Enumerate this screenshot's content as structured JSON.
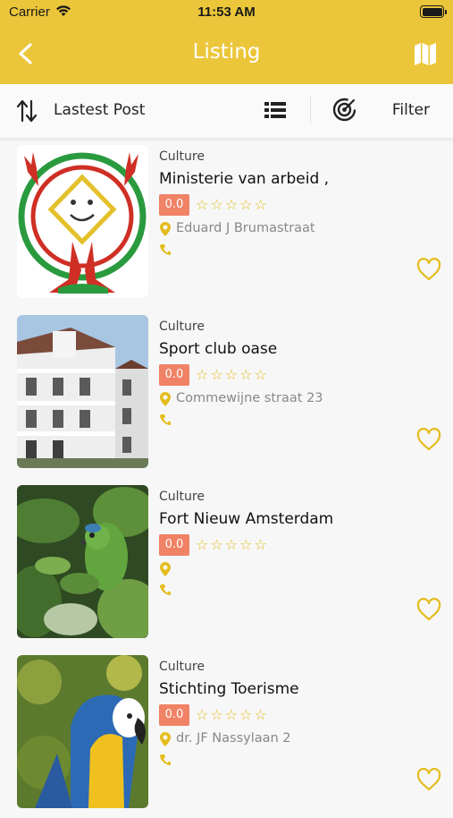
{
  "status_bar": {
    "carrier": "Carrier",
    "time": "11:53 AM"
  },
  "header": {
    "title": "Listing",
    "back_icon": "chevron-left-icon",
    "map_icon": "map-icon"
  },
  "toolbar": {
    "sort_label": "Lastest Post",
    "filter_label": "Filter"
  },
  "colors": {
    "accent": "#ecc63a",
    "rating_badge": "#f08266",
    "star": "#e4bc1c"
  },
  "listings": [
    {
      "category": "Culture",
      "name": "Ministerie van arbeid ,",
      "rating": "0.0",
      "stars": "☆☆☆☆☆",
      "address": "Eduard J Brumastraat"
    },
    {
      "category": "Culture",
      "name": "Sport club oase",
      "rating": "0.0",
      "stars": "☆☆☆☆☆",
      "address": "Commewijne straat 23"
    },
    {
      "category": "Culture",
      "name": "Fort Nieuw Amsterdam",
      "rating": "0.0",
      "stars": "☆☆☆☆☆",
      "address": ""
    },
    {
      "category": "Culture",
      "name": "Stichting Toerisme",
      "rating": "0.0",
      "stars": "☆☆☆☆☆",
      "address": "dr. JF Nassylaan 2"
    }
  ]
}
